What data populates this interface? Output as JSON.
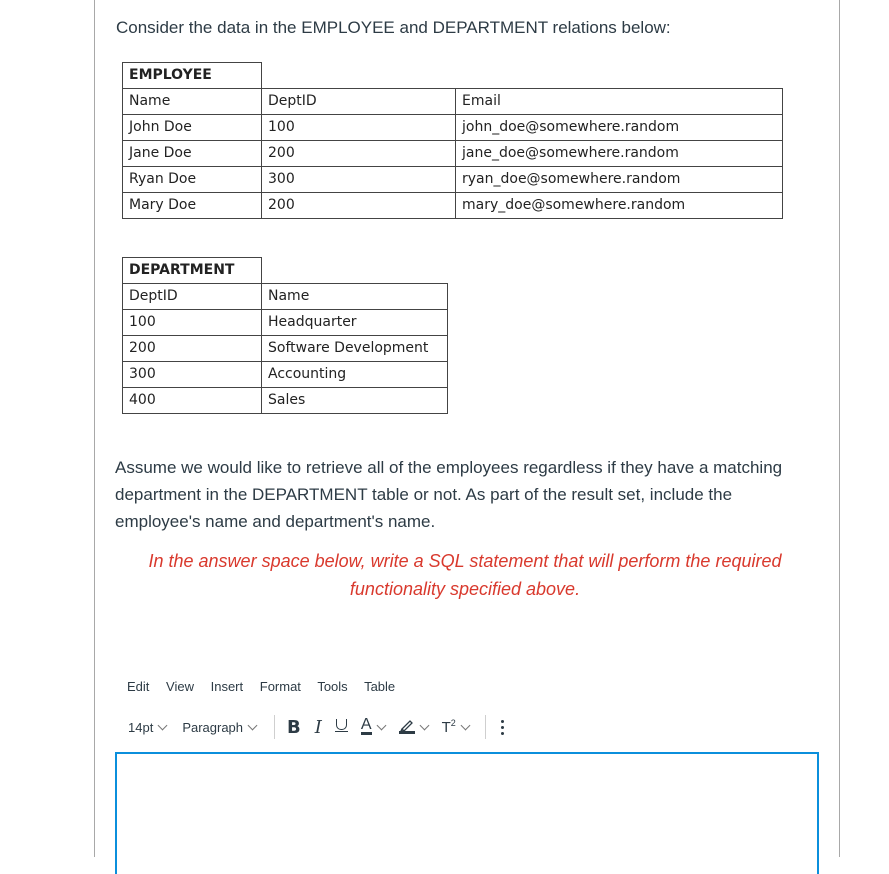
{
  "intro_text": "Consider the data in the EMPLOYEE and DEPARTMENT relations below:",
  "employee_table": {
    "title": "EMPLOYEE",
    "headers": [
      "Name",
      "DeptID",
      "Email"
    ],
    "rows": [
      [
        "John Doe",
        "100",
        "john_doe@somewhere.random"
      ],
      [
        "Jane Doe",
        "200",
        "jane_doe@somewhere.random"
      ],
      [
        "Ryan Doe",
        "300",
        "ryan_doe@somewhere.random"
      ],
      [
        "Mary Doe",
        "200",
        "mary_doe@somewhere.random"
      ]
    ]
  },
  "department_table": {
    "title": "DEPARTMENT",
    "headers": [
      "DeptID",
      "Name"
    ],
    "rows": [
      [
        "100",
        "Headquarter"
      ],
      [
        "200",
        "Software Development"
      ],
      [
        "300",
        "Accounting"
      ],
      [
        "400",
        "Sales"
      ]
    ]
  },
  "prompt_text": "Assume we would like to retrieve all of the employees regardless if they have a matching department in the DEPARTMENT table or not. As part of the result set, include the employee's name and department's name.",
  "instruction_text": "In the answer space below, write a SQL statement that will perform the required functionality specified above.",
  "instruction_color": "#d9392d",
  "editor": {
    "menu": [
      "Edit",
      "View",
      "Insert",
      "Format",
      "Tools",
      "Table"
    ],
    "toolbar": {
      "font_size": "14pt",
      "block_format": "Paragraph",
      "bold_icon": "bold-icon",
      "italic_icon": "italic-icon",
      "underline_icon": "underline-icon",
      "text_color_icon": "text-color-icon",
      "highlight_icon": "highlight-color-icon",
      "superscript_icon": "superscript-icon",
      "more_icon": "more-vertical-icon"
    },
    "bold_label": "B",
    "italic_label": "I",
    "text_color_label": "A",
    "superscript_label": "T",
    "superscript_exp": "2",
    "content": "",
    "focus_color": "#0b8fdc"
  }
}
